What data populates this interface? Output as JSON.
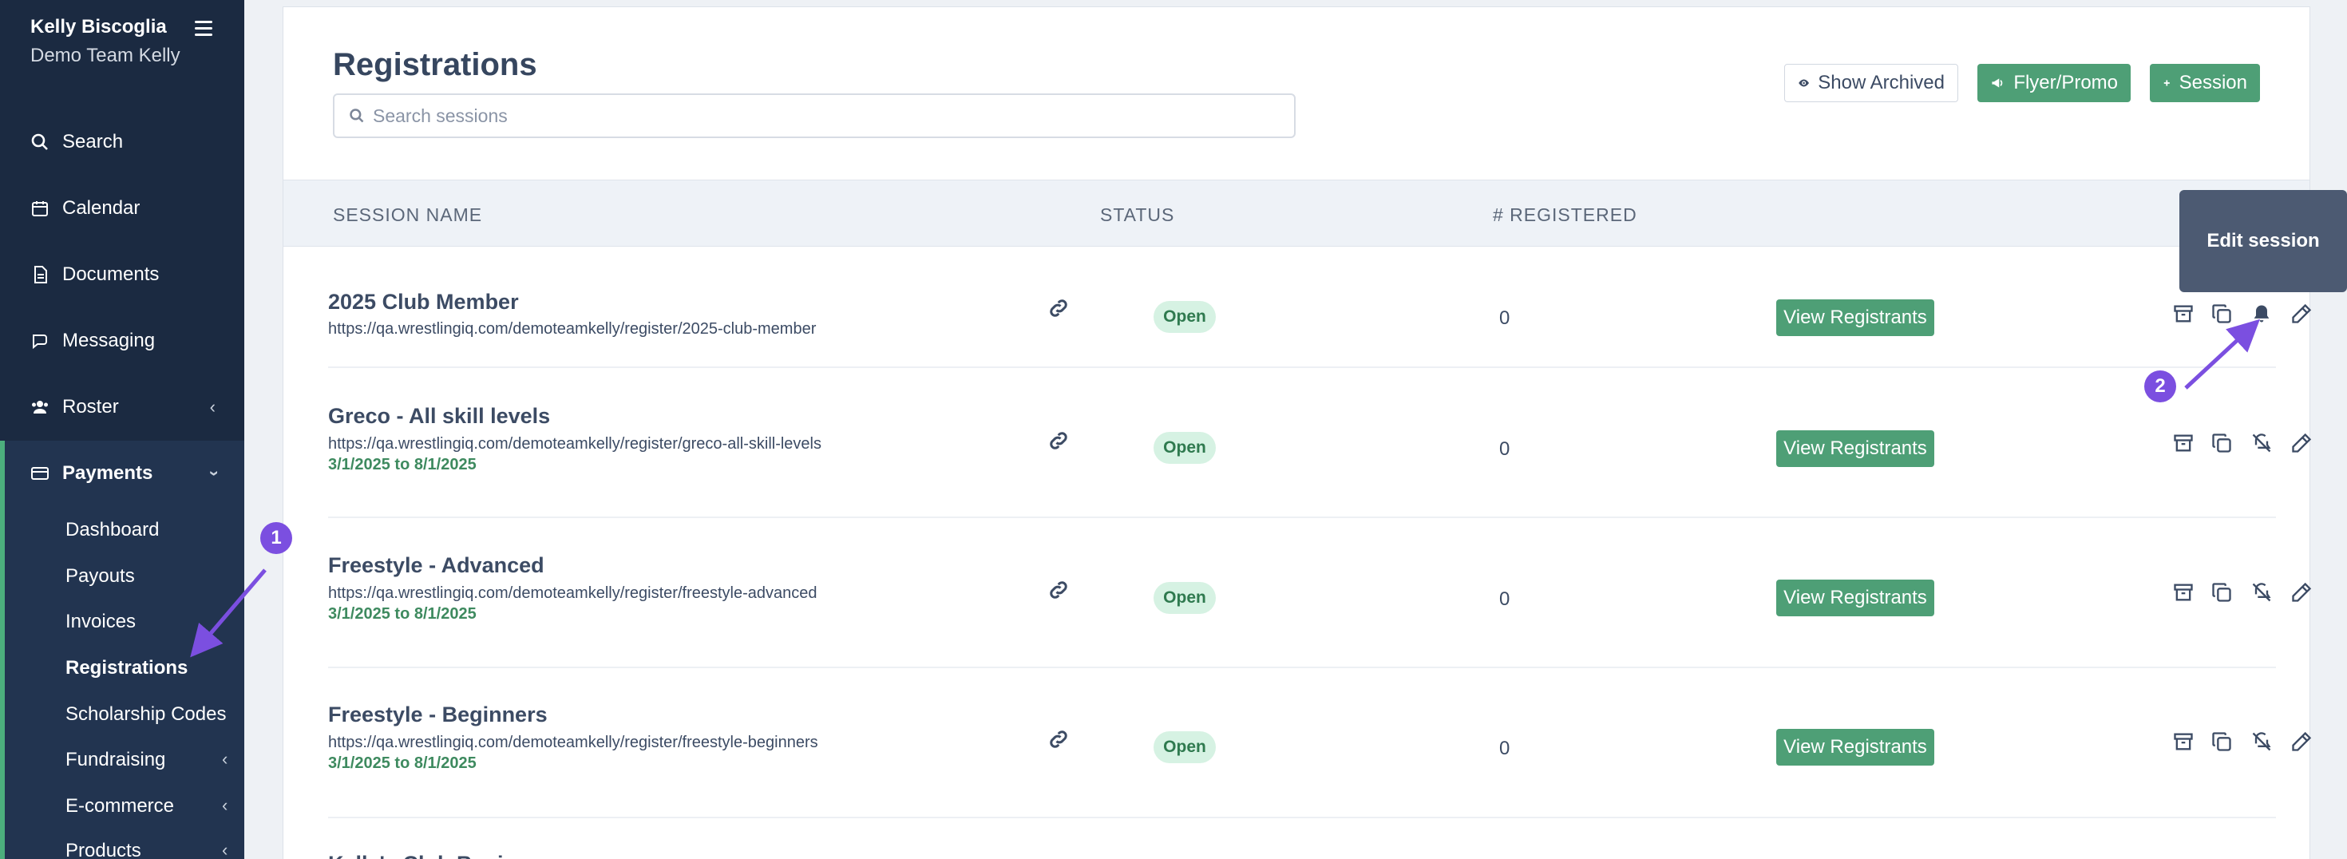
{
  "sidebar": {
    "user_name": "Kelly Biscoglia",
    "team_name": "Demo Team Kelly",
    "nav": [
      {
        "label": "Search",
        "icon": "search-icon"
      },
      {
        "label": "Calendar",
        "icon": "calendar-icon"
      },
      {
        "label": "Documents",
        "icon": "document-icon"
      },
      {
        "label": "Messaging",
        "icon": "messaging-icon"
      },
      {
        "label": "Roster",
        "icon": "users-icon"
      },
      {
        "label": "Payments",
        "icon": "credit-card-icon"
      }
    ],
    "payments_sub": [
      {
        "label": "Dashboard"
      },
      {
        "label": "Payouts"
      },
      {
        "label": "Invoices"
      },
      {
        "label": "Registrations"
      },
      {
        "label": "Scholarship Codes"
      },
      {
        "label": "Fundraising"
      },
      {
        "label": "E-commerce"
      },
      {
        "label": "Products"
      }
    ]
  },
  "header": {
    "title": "Registrations",
    "search_placeholder": "Search sessions",
    "show_archived_label": "Show Archived",
    "flyer_label": "Flyer/Promo",
    "session_label": "Session"
  },
  "table": {
    "columns": [
      "SESSION NAME",
      "STATUS",
      "# REGISTERED"
    ],
    "view_label": "View Registrants",
    "rows": [
      {
        "name": "2025 Club Member",
        "url": "https://qa.wrestlingiq.com/demoteamkelly/register/2025-club-member",
        "dates": "",
        "status": "Open",
        "registered": "0"
      },
      {
        "name": "Greco - All skill levels",
        "url": "https://qa.wrestlingiq.com/demoteamkelly/register/greco-all-skill-levels",
        "dates": "3/1/2025 to 8/1/2025",
        "status": "Open",
        "registered": "0"
      },
      {
        "name": "Freestyle - Advanced",
        "url": "https://qa.wrestlingiq.com/demoteamkelly/register/freestyle-advanced",
        "dates": "3/1/2025 to 8/1/2025",
        "status": "Open",
        "registered": "0"
      },
      {
        "name": "Freestyle - Beginners",
        "url": "https://qa.wrestlingiq.com/demoteamkelly/register/freestyle-beginners",
        "dates": "3/1/2025 to 8/1/2025",
        "status": "Open",
        "registered": "0"
      },
      {
        "name": "Kelly's Club Beginners"
      }
    ]
  },
  "tooltip": {
    "text": "Edit session"
  },
  "annotations": {
    "marker1": "1",
    "marker2": "2",
    "color": "#7b4fe0"
  },
  "colors": {
    "sidebar": "#1b2a41",
    "accent_green": "#4e9f76",
    "active_bar": "#4caf7d"
  }
}
